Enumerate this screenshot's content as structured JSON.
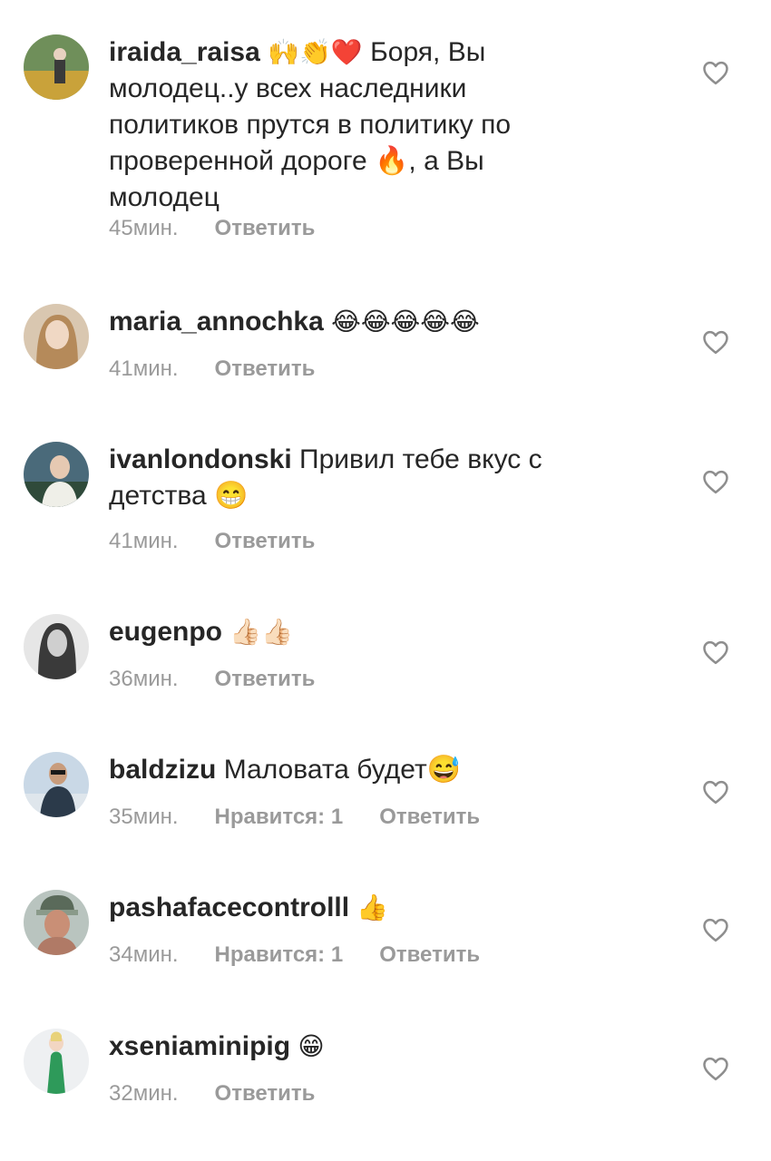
{
  "comments": [
    {
      "username": "iraida_raisa",
      "emoji_prefix": "🙌👏❤️",
      "text": "Боря,  Вы молодец..у всех наследники политиков прутся в политику по проверенной дороге 🔥, а Вы молодец",
      "time": "45мин.",
      "likes": "",
      "reply_label": "Ответить"
    },
    {
      "username": "maria_annochka",
      "emoji_prefix": "😂😂😂😂😂",
      "text": "",
      "time": "41мин.",
      "likes": "",
      "reply_label": "Ответить"
    },
    {
      "username": "ivanlondonski",
      "emoji_prefix": "",
      "text": "Привил тебе вкус с детства 😁",
      "time": "41мин.",
      "likes": "",
      "reply_label": "Ответить"
    },
    {
      "username": "eugenpo",
      "emoji_prefix": "👍🏻👍🏻",
      "text": "",
      "time": "36мин.",
      "likes": "",
      "reply_label": "Ответить"
    },
    {
      "username": "baldzizu",
      "emoji_prefix": "",
      "text": "Маловата будет😅",
      "time": "35мин.",
      "likes": "Нравится: 1",
      "reply_label": "Ответить"
    },
    {
      "username": "pashafacecontrolll",
      "emoji_prefix": "👍",
      "text": "",
      "time": "34мин.",
      "likes": "Нравится: 1",
      "reply_label": "Ответить"
    },
    {
      "username": "xseniaminipig",
      "emoji_prefix": "😁",
      "text": "",
      "time": "32мин.",
      "likes": "",
      "reply_label": "Ответить"
    }
  ],
  "colors": {
    "username": "#262626",
    "meta": "#9a9a9a",
    "heart_stroke": "#8e8e8e"
  },
  "icons": {
    "like": "heart-outline-icon"
  }
}
